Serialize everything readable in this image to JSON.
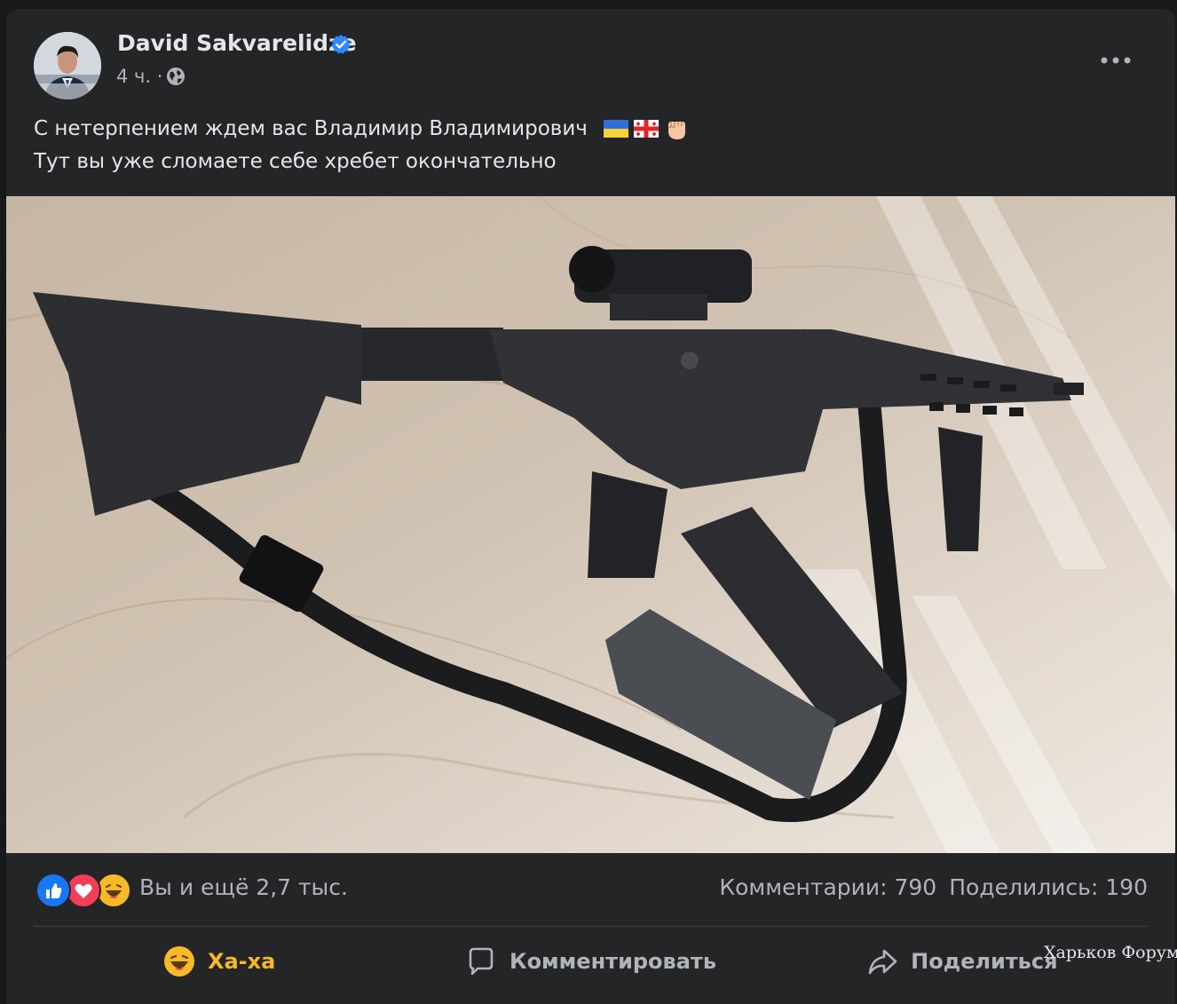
{
  "post": {
    "author": "David Sakvarelidze",
    "verified": true,
    "time": "4 ч. ·",
    "privacy_icon": "globe-icon",
    "more_icon": "more-options-icon",
    "text_line1": "С нетерпением ждем вас Владимир Владимирович",
    "text_line1_emoji": [
      "ukraine-flag",
      "georgia-flag",
      "raised-fist"
    ],
    "text_line2": "Тут вы уже сломаете себе хребет окончательно",
    "photo_subject": "rifle-with-magazines-on-marble"
  },
  "reactions": {
    "icons": [
      "like",
      "love",
      "haha"
    ],
    "summary": "Вы и ещё 2,7 тыс.",
    "comments": "Комментарии: 790",
    "shares": "Поделились: 190"
  },
  "actions": {
    "react_label": "Ха-ха",
    "comment_label": "Комментировать",
    "share_label": "Поделиться"
  },
  "watermark": "Харьков Форум",
  "colors": {
    "background": "#18191a",
    "card": "#242526",
    "text_primary": "#e4e6eb",
    "text_secondary": "#b0b3b8",
    "verified_blue": "#2d88ff",
    "haha_yellow": "#f7b928",
    "love_red": "#f33e58"
  }
}
